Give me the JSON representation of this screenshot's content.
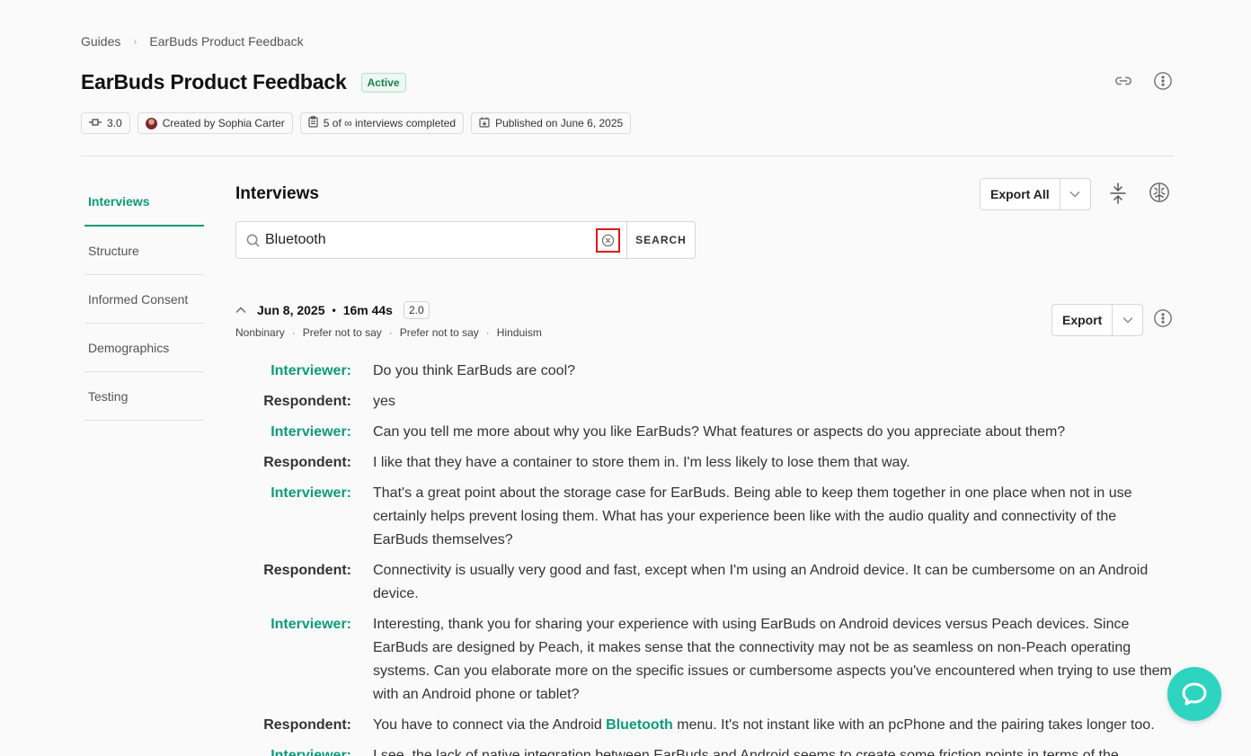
{
  "breadcrumb": {
    "root": "Guides",
    "current": "EarBuds Product Feedback"
  },
  "page": {
    "title": "EarBuds Product Feedback",
    "status": "Active"
  },
  "meta": {
    "version": "3.0",
    "creator": "Created by Sophia Carter",
    "completion": "5 of ∞ interviews completed",
    "published": "Published on June 6, 2025"
  },
  "nav": {
    "items": [
      {
        "label": "Interviews",
        "active": true
      },
      {
        "label": "Structure"
      },
      {
        "label": "Informed Consent"
      },
      {
        "label": "Demographics"
      },
      {
        "label": "Testing"
      }
    ]
  },
  "section": {
    "title": "Interviews",
    "export_all": "Export All"
  },
  "search": {
    "value": "Bluetooth",
    "button": "SEARCH"
  },
  "interview": {
    "date": "Jun 8, 2025",
    "duration": "16m 44s",
    "version": "2.0",
    "export": "Export",
    "demographics": [
      "Nonbinary",
      "Prefer not to say",
      "Prefer not to say",
      "Hinduism"
    ]
  },
  "transcript": [
    {
      "speaker": "Interviewer:",
      "text": "Do you think EarBuds are cool?"
    },
    {
      "speaker": "Respondent:",
      "text": "yes"
    },
    {
      "speaker": "Interviewer:",
      "text": "Can you tell me more about why you like EarBuds? What features or aspects do you appreciate about them?"
    },
    {
      "speaker": "Respondent:",
      "text": "I like that they have a container to store them in. I'm less likely to lose them that way."
    },
    {
      "speaker": "Interviewer:",
      "text": "That's a great point about the storage case for EarBuds. Being able to keep them together in one place when not in use certainly helps prevent losing them. What has your experience been like with the audio quality and connectivity of the EarBuds themselves?"
    },
    {
      "speaker": "Respondent:",
      "text": "Connectivity is usually very good and fast, except when I'm using an Android device. It can be cumbersome on an Android device."
    },
    {
      "speaker": "Interviewer:",
      "text": "Interesting, thank you for sharing your experience with using EarBuds on Android devices versus Peach devices. Since EarBuds are designed by Peach, it makes sense that the connectivity may not be as seamless on non-Peach operating systems. Can you elaborate more on the specific issues or cumbersome aspects you've encountered when trying to use them with an Android phone or tablet?"
    },
    {
      "speaker": "Respondent:",
      "text_before": "You have to connect via the Android ",
      "highlight": "Bluetooth",
      "text_after": " menu. It's not instant like with an pcPhone and the pairing takes longer too."
    },
    {
      "speaker": "Interviewer:",
      "text": "I see, the lack of native integration between EarBuds and Android seems to create some friction points in terms of the"
    }
  ],
  "colors": {
    "accent": "#0f9a7a",
    "fab": "#2dd4bf",
    "clear_highlight": "#e0161e"
  }
}
